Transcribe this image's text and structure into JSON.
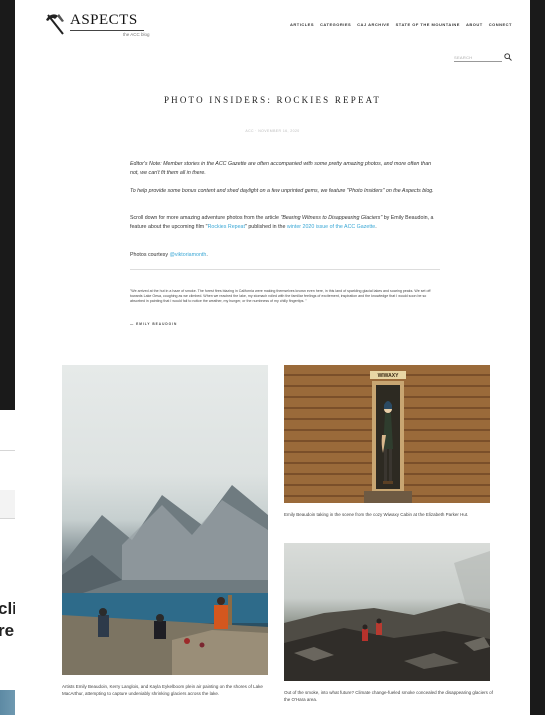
{
  "blog": {
    "name": "ASPECTS",
    "tagline": "the ACC blog"
  },
  "nav": [
    "ARTICLES",
    "CATEGORIES",
    "CAJ ARCHIVE",
    "STATE OF THE MOUNTAINE",
    "ABOUT",
    "CONNECT"
  ],
  "search": {
    "placeholder": "SEARCH"
  },
  "post": {
    "title": "PHOTO INSIDERS: ROCKIES REPEAT",
    "meta": "ACC · NOVEMBER 16, 2020",
    "editor_note": "Editor's Note: Member stories in the ACC Gazette are often accompanied with some pretty amazing photos, and more often than not, we can't fit them all in there.",
    "bonus_note": "To help provide some bonus content and shed daylight on a few unprinted gems, we feature \"Photo Insiders\" on the Aspects blog.",
    "scroll_pre": "Scroll down for more amazing adventure photos from the article ",
    "scroll_article": "\"Bearing Witness to Disappearing Glaciers\"",
    "scroll_mid": " by Emily Beaudoin, a feature about the upcoming film \"",
    "scroll_film_link": "Rockies Repeat",
    "scroll_mid2": "\" published in the ",
    "scroll_issue_link": "winter 2020 issue of the ACC Gazette",
    "scroll_end": ".",
    "credit_pre": "Photos courtesy ",
    "credit_link": "@viktoriamonth",
    "credit_end": ".",
    "quote": "\"We arrived at the hut in a haze of smoke. The forest fires blazing in California were making themselves known even here, in this land of sparkling glacial lakes and soaring peaks. We set off towards Lake Oesa, coughing as we climbed. When we reached the lake, my stomach roiled with the familiar feelings of excitement, inspiration and the knowledge that I would soon be so absorbed in painting that I would fail to notice the weather, my hunger, or the numbness of my chilly fingertips. \"",
    "attribution": "— EMILY BEAUDOIN"
  },
  "captions": {
    "lake": "Artists Emily Beaudoin, Kerry Langlois, and Kayla Eykelboom plein air painting on the shores of Lake MacArthur, attempting to capture undeniably shrinking glaciers across the lake.",
    "cabin": "Emily Beaudoin taking in the scene from the cozy Wiwaxy Cabin at the Elizabeth Parker Hut.",
    "smoke": "Out of the smoke, into what future? Climate change-fueled smoke concealed the disappearing glaciers of the O'Hara area."
  },
  "cabin_sign": "WIWAXY",
  "background_window": {
    "heading": "clir\nre"
  },
  "colors": {
    "link": "#3aa7d5",
    "backdrop": "#1a1a1a"
  }
}
